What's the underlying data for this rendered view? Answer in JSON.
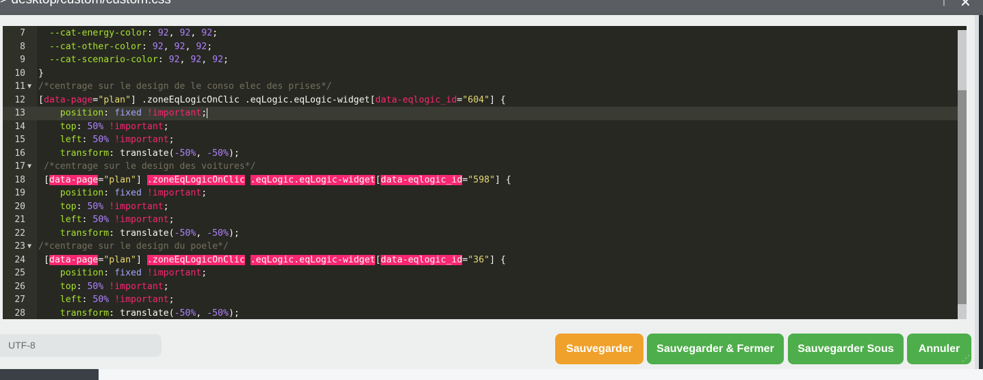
{
  "window": {
    "title": "> desktop/custom/custom.css",
    "controls": [
      "↑",
      "✕"
    ]
  },
  "editor": {
    "lines": [
      {
        "n": "7",
        "fold": "",
        "active": false,
        "tokens": [
          [
            "",
            "  "
          ],
          [
            "prop",
            "--cat-energy-color"
          ],
          [
            "",
            ": "
          ],
          [
            "num",
            "92"
          ],
          [
            "",
            ", "
          ],
          [
            "num",
            "92"
          ],
          [
            "",
            ", "
          ],
          [
            "num",
            "92"
          ],
          [
            "",
            ";"
          ]
        ]
      },
      {
        "n": "8",
        "fold": "",
        "active": false,
        "tokens": [
          [
            "",
            "  "
          ],
          [
            "prop",
            "--cat-other-color"
          ],
          [
            "",
            ": "
          ],
          [
            "num",
            "92"
          ],
          [
            "",
            ", "
          ],
          [
            "num",
            "92"
          ],
          [
            "",
            ", "
          ],
          [
            "num",
            "92"
          ],
          [
            "",
            ";"
          ]
        ]
      },
      {
        "n": "9",
        "fold": "",
        "active": false,
        "tokens": [
          [
            "",
            "  "
          ],
          [
            "prop",
            "--cat-scenario-color"
          ],
          [
            "",
            ": "
          ],
          [
            "num",
            "92"
          ],
          [
            "",
            ", "
          ],
          [
            "num",
            "92"
          ],
          [
            "",
            ", "
          ],
          [
            "num",
            "92"
          ],
          [
            "",
            ";"
          ]
        ]
      },
      {
        "n": "10",
        "fold": "",
        "active": false,
        "tokens": [
          [
            "",
            "}"
          ]
        ]
      },
      {
        "n": "11",
        "fold": "▼",
        "active": false,
        "tokens": [
          [
            "cmt",
            "/*centrage sur le design de le conso elec des prises*/"
          ]
        ]
      },
      {
        "n": "12",
        "fold": "",
        "active": false,
        "tokens": [
          [
            "",
            "["
          ],
          [
            "attr",
            "data-page"
          ],
          [
            "",
            "="
          ],
          [
            "str",
            "\"plan\""
          ],
          [
            "",
            "] .zoneEqLogicOnClic .eqLogic.eqLogic-widget["
          ],
          [
            "attr",
            "data-eqlogic_id"
          ],
          [
            "",
            "="
          ],
          [
            "str",
            "\"604\""
          ],
          [
            "",
            "] {"
          ]
        ]
      },
      {
        "n": "13",
        "fold": "",
        "active": true,
        "tokens": [
          [
            "",
            "    "
          ],
          [
            "prop",
            "position"
          ],
          [
            "",
            ": "
          ],
          [
            "kw",
            "fixed"
          ],
          [
            "",
            ""
          ],
          [
            "imp",
            " !important"
          ],
          [
            "",
            ";"
          ],
          [
            "cursor",
            ""
          ]
        ]
      },
      {
        "n": "14",
        "fold": "",
        "active": false,
        "tokens": [
          [
            "",
            "    "
          ],
          [
            "prop",
            "top"
          ],
          [
            "",
            ": "
          ],
          [
            "num",
            "50%"
          ],
          [
            "imp",
            " !important"
          ],
          [
            "",
            ";"
          ]
        ]
      },
      {
        "n": "15",
        "fold": "",
        "active": false,
        "tokens": [
          [
            "",
            "    "
          ],
          [
            "prop",
            "left"
          ],
          [
            "",
            ": "
          ],
          [
            "num",
            "50%"
          ],
          [
            "imp",
            " !important"
          ],
          [
            "",
            ";"
          ]
        ]
      },
      {
        "n": "16",
        "fold": "",
        "active": false,
        "tokens": [
          [
            "",
            "    "
          ],
          [
            "prop",
            "transform"
          ],
          [
            "",
            ": translate("
          ],
          [
            "num",
            "-50%"
          ],
          [
            "",
            ", "
          ],
          [
            "num",
            "-50%"
          ],
          [
            "",
            ");"
          ]
        ]
      },
      {
        "n": "17",
        "fold": "▼",
        "active": false,
        "tokens": [
          [
            "cmt",
            " /*centrage sur le design des voitures*/"
          ]
        ]
      },
      {
        "n": "18",
        "fold": "",
        "active": false,
        "tokens": [
          [
            "",
            ""
          ],
          [
            "",
            " ["
          ],
          [
            "hl",
            "data-page"
          ],
          [
            "",
            "="
          ],
          [
            "str",
            "\"plan\""
          ],
          [
            "",
            "] "
          ],
          [
            "hl",
            ".zoneEqLogicOnClic"
          ],
          [
            "",
            " "
          ],
          [
            "hl",
            ".eqLogic.eqLogic-widget"
          ],
          [
            "",
            "["
          ],
          [
            "hl",
            "data-eqlogic_id"
          ],
          [
            "",
            "="
          ],
          [
            "str",
            "\"598\""
          ],
          [
            "",
            "] {"
          ]
        ]
      },
      {
        "n": "19",
        "fold": "",
        "active": false,
        "tokens": [
          [
            "",
            "    "
          ],
          [
            "prop",
            "position"
          ],
          [
            "",
            ": "
          ],
          [
            "kw",
            "fixed"
          ],
          [
            "imp",
            " !important"
          ],
          [
            "",
            ";"
          ]
        ]
      },
      {
        "n": "20",
        "fold": "",
        "active": false,
        "tokens": [
          [
            "",
            "    "
          ],
          [
            "prop",
            "top"
          ],
          [
            "",
            ": "
          ],
          [
            "num",
            "50%"
          ],
          [
            "imp",
            " !important"
          ],
          [
            "",
            ";"
          ]
        ]
      },
      {
        "n": "21",
        "fold": "",
        "active": false,
        "tokens": [
          [
            "",
            "    "
          ],
          [
            "prop",
            "left"
          ],
          [
            "",
            ": "
          ],
          [
            "num",
            "50%"
          ],
          [
            "imp",
            " !important"
          ],
          [
            "",
            ";"
          ]
        ]
      },
      {
        "n": "22",
        "fold": "",
        "active": false,
        "tokens": [
          [
            "",
            "    "
          ],
          [
            "prop",
            "transform"
          ],
          [
            "",
            ": translate("
          ],
          [
            "num",
            "-50%"
          ],
          [
            "",
            ", "
          ],
          [
            "num",
            "-50%"
          ],
          [
            "",
            ");"
          ]
        ]
      },
      {
        "n": "23",
        "fold": "▼",
        "active": false,
        "tokens": [
          [
            "cmt",
            "/*centrage sur le design du poele*/"
          ]
        ]
      },
      {
        "n": "24",
        "fold": "",
        "active": false,
        "tokens": [
          [
            "",
            " ["
          ],
          [
            "hl",
            "data-page"
          ],
          [
            "",
            "="
          ],
          [
            "str",
            "\"plan\""
          ],
          [
            "",
            "] "
          ],
          [
            "hl",
            ".zoneEqLogicOnClic"
          ],
          [
            "",
            " "
          ],
          [
            "hl",
            ".eqLogic.eqLogic-widget"
          ],
          [
            "",
            "["
          ],
          [
            "hl",
            "data-eqlogic_id"
          ],
          [
            "",
            "="
          ],
          [
            "str",
            "\"36\""
          ],
          [
            "",
            "] {"
          ]
        ]
      },
      {
        "n": "25",
        "fold": "",
        "active": false,
        "tokens": [
          [
            "",
            "    "
          ],
          [
            "prop",
            "position"
          ],
          [
            "",
            ": "
          ],
          [
            "kw",
            "fixed"
          ],
          [
            "imp",
            " !important"
          ],
          [
            "",
            ";"
          ]
        ]
      },
      {
        "n": "26",
        "fold": "",
        "active": false,
        "tokens": [
          [
            "",
            "    "
          ],
          [
            "prop",
            "top"
          ],
          [
            "",
            ": "
          ],
          [
            "num",
            "50%"
          ],
          [
            "imp",
            " !important"
          ],
          [
            "",
            ";"
          ]
        ]
      },
      {
        "n": "27",
        "fold": "",
        "active": false,
        "tokens": [
          [
            "",
            "    "
          ],
          [
            "prop",
            "left"
          ],
          [
            "",
            ": "
          ],
          [
            "num",
            "50%"
          ],
          [
            "imp",
            " !important"
          ],
          [
            "",
            ";"
          ]
        ]
      },
      {
        "n": "28",
        "fold": "",
        "active": false,
        "tokens": [
          [
            "",
            "    "
          ],
          [
            "prop",
            "transform"
          ],
          [
            "",
            ": translate("
          ],
          [
            "num",
            "-50%"
          ],
          [
            "",
            ", "
          ],
          [
            "num",
            "-50%"
          ],
          [
            "",
            ");"
          ]
        ]
      }
    ]
  },
  "footer": {
    "encoding": "UTF-8",
    "buttons": {
      "save": "Sauvegarder",
      "save_close": "Sauvegarder & Fermer",
      "save_as": "Sauvegarder Sous",
      "cancel": "Annuler"
    }
  },
  "colors": {
    "save": "#f0a12b",
    "success": "#4eae4b",
    "editor_bg": "#272822"
  }
}
